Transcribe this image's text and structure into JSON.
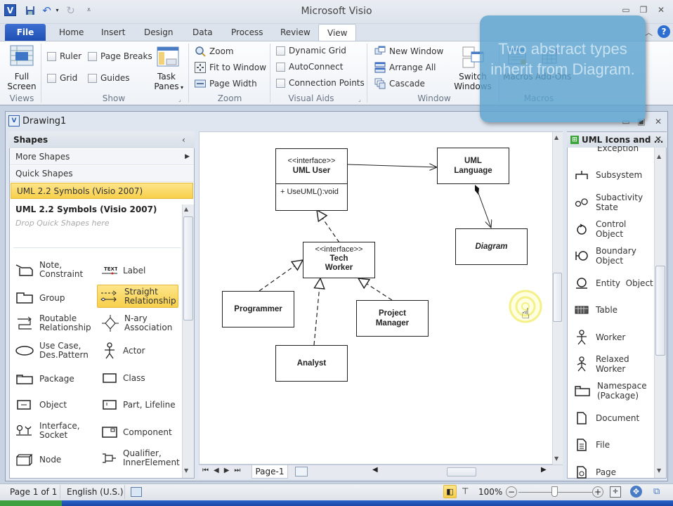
{
  "app_title": "Microsoft Visio",
  "ribbon_tabs": [
    {
      "label": "File"
    },
    {
      "label": "Home"
    },
    {
      "label": "Insert"
    },
    {
      "label": "Design"
    },
    {
      "label": "Data"
    },
    {
      "label": "Process"
    },
    {
      "label": "Review"
    },
    {
      "label": "View",
      "active": true
    }
  ],
  "ribbon": {
    "views": {
      "label": "Views",
      "full_screen": "Full\nScreen"
    },
    "show": {
      "label": "Show",
      "ruler": "Ruler",
      "page_breaks": "Page Breaks",
      "grid": "Grid",
      "guides": "Guides",
      "task_panes": "Task Panes"
    },
    "zoom": {
      "label": "Zoom",
      "zoom": "Zoom",
      "fit_to_window": "Fit to Window",
      "page_width": "Page Width"
    },
    "visual_aids": {
      "label": "Visual Aids",
      "dynamic_grid": "Dynamic Grid",
      "autoconnect": "AutoConnect",
      "connection_points": "Connection Points"
    },
    "window": {
      "label": "Window",
      "new_window": "New Window",
      "arrange_all": "Arrange All",
      "cascade": "Cascade",
      "switch_windows": "Switch Windows"
    },
    "macros": {
      "label": "Macros",
      "macros": "Macros",
      "add_ons": "Add-Ons"
    }
  },
  "callout": {
    "text": "Two abstract types inherit from Diagram."
  },
  "document": {
    "title": "Drawing1"
  },
  "shapes_pane": {
    "title": "Shapes",
    "more_shapes": "More Shapes",
    "quick_shapes": "Quick Shapes",
    "selected_stencil": "UML 2.2 Symbols (Visio 2007)",
    "stencil_header": "UML 2.2 Symbols (Visio 2007)",
    "drop_hint": "Drop Quick Shapes here",
    "items": [
      {
        "label": "Note, Constraint",
        "icon": "note-icon"
      },
      {
        "label": "Label",
        "icon": "label-icon"
      },
      {
        "label": "Group",
        "icon": "group-icon"
      },
      {
        "label": "Straight Relationship",
        "icon": "straight-relationship-icon",
        "selected": true
      },
      {
        "label": "Routable Relationship",
        "icon": "routable-relationship-icon"
      },
      {
        "label": "N-ary Association",
        "icon": "nary-association-icon"
      },
      {
        "label": "Use Case, Des.Pattern",
        "icon": "use-case-icon"
      },
      {
        "label": "Actor",
        "icon": "actor-icon"
      },
      {
        "label": "Package",
        "icon": "package-icon"
      },
      {
        "label": "Class",
        "icon": "class-icon"
      },
      {
        "label": "Object",
        "icon": "object-icon"
      },
      {
        "label": "Part, Lifeline",
        "icon": "part-lifeline-icon"
      },
      {
        "label": "Interface, Socket",
        "icon": "interface-socket-icon"
      },
      {
        "label": "Component",
        "icon": "component-icon"
      },
      {
        "label": "Node",
        "icon": "node-icon"
      },
      {
        "label": "Qualifier, InnerElement",
        "icon": "qualifier-icon"
      }
    ]
  },
  "diagram": {
    "uml_user": {
      "stereotype": "<<interface>>",
      "name": "UML User",
      "operation": "+ UseUML():void"
    },
    "uml_language": {
      "name": "UML Language"
    },
    "diagram": {
      "name": "Diagram"
    },
    "tech_worker": {
      "stereotype": "<<interface>>",
      "name": "Tech Worker"
    },
    "programmer": {
      "name": "Programmer"
    },
    "analyst": {
      "name": "Analyst"
    },
    "project_manager": {
      "name": "Project Manager"
    }
  },
  "page_tabs": [
    {
      "label": "Page-1"
    }
  ],
  "uml_pane": {
    "title": "UML Icons and ...",
    "items": [
      {
        "label": "Exception",
        "icon": "exception-icon"
      },
      {
        "label": "Subsystem",
        "icon": "subsystem-icon"
      },
      {
        "label": "Subactivity State",
        "icon": "subactivity-state-icon"
      },
      {
        "label": "Control Object",
        "icon": "control-object-icon"
      },
      {
        "label": "Boundary Object",
        "icon": "boundary-object-icon"
      },
      {
        "label": "Entity  Object",
        "icon": "entity-object-icon"
      },
      {
        "label": "Table",
        "icon": "table-icon"
      },
      {
        "label": "Worker",
        "icon": "worker-icon"
      },
      {
        "label": "Relaxed Worker",
        "icon": "relaxed-worker-icon"
      },
      {
        "label": "Namespace (Package)",
        "icon": "namespace-icon"
      },
      {
        "label": "Document",
        "icon": "document-icon"
      },
      {
        "label": "File",
        "icon": "file-icon"
      },
      {
        "label": "Page",
        "icon": "page-icon"
      }
    ]
  },
  "status_bar": {
    "page": "Page 1 of 1",
    "language": "English (U.S.)",
    "zoom": "100%"
  }
}
